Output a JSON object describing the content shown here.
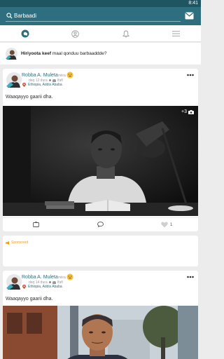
{
  "status_bar": {
    "time": "8:41"
  },
  "search": {
    "placeholder": "Barbaadi"
  },
  "composer": {
    "bold": "Hiriyoota keef",
    "text": "maal qonduu barbaaddde?"
  },
  "posts": [
    {
      "author": "Robba A. Muleta",
      "feeling": "miira",
      "time": "deq 12 dura",
      "audience": "Ifafi",
      "location": "Ethiopia, Addis Ababa",
      "text": "Waaqayyo gaarii dha.",
      "photo_badge": "+3",
      "likes": "1"
    },
    {
      "author": "Robba A. Muleta",
      "feeling": "miira",
      "time": "deq 14 dura",
      "audience": "Ifafi",
      "location": "Ethiopia, Addis Ababa",
      "text": "Waaqayyo gaarii dha."
    }
  ],
  "sponsored": {
    "label": "Sponsored"
  },
  "colors": {
    "primary": "#2d6f7e",
    "status": "#1f5560",
    "accent": "#f39c12"
  }
}
